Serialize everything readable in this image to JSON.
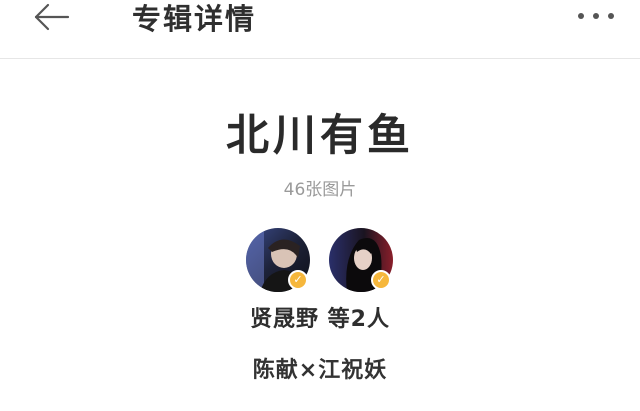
{
  "header": {
    "back_icon": "arrow-left-icon",
    "title": "专辑详情",
    "more_icon": "more-horizontal-icon"
  },
  "album": {
    "title": "北川有鱼",
    "photo_count": "46张图片",
    "authors_label": "贤晟野 等2人",
    "tag": "陈献×江祝妖"
  },
  "avatars": [
    {
      "icon": "user-avatar",
      "verified_icon": "verified-badge-icon",
      "badge_color": "#f6b73c"
    },
    {
      "icon": "user-avatar",
      "verified_icon": "verified-badge-icon",
      "badge_color": "#f6b73c"
    }
  ],
  "colors": {
    "title_text": "#2a2a2a",
    "muted_text": "#9a9a9a",
    "divider": "#e6e6e6",
    "badge": "#f6b73c"
  }
}
